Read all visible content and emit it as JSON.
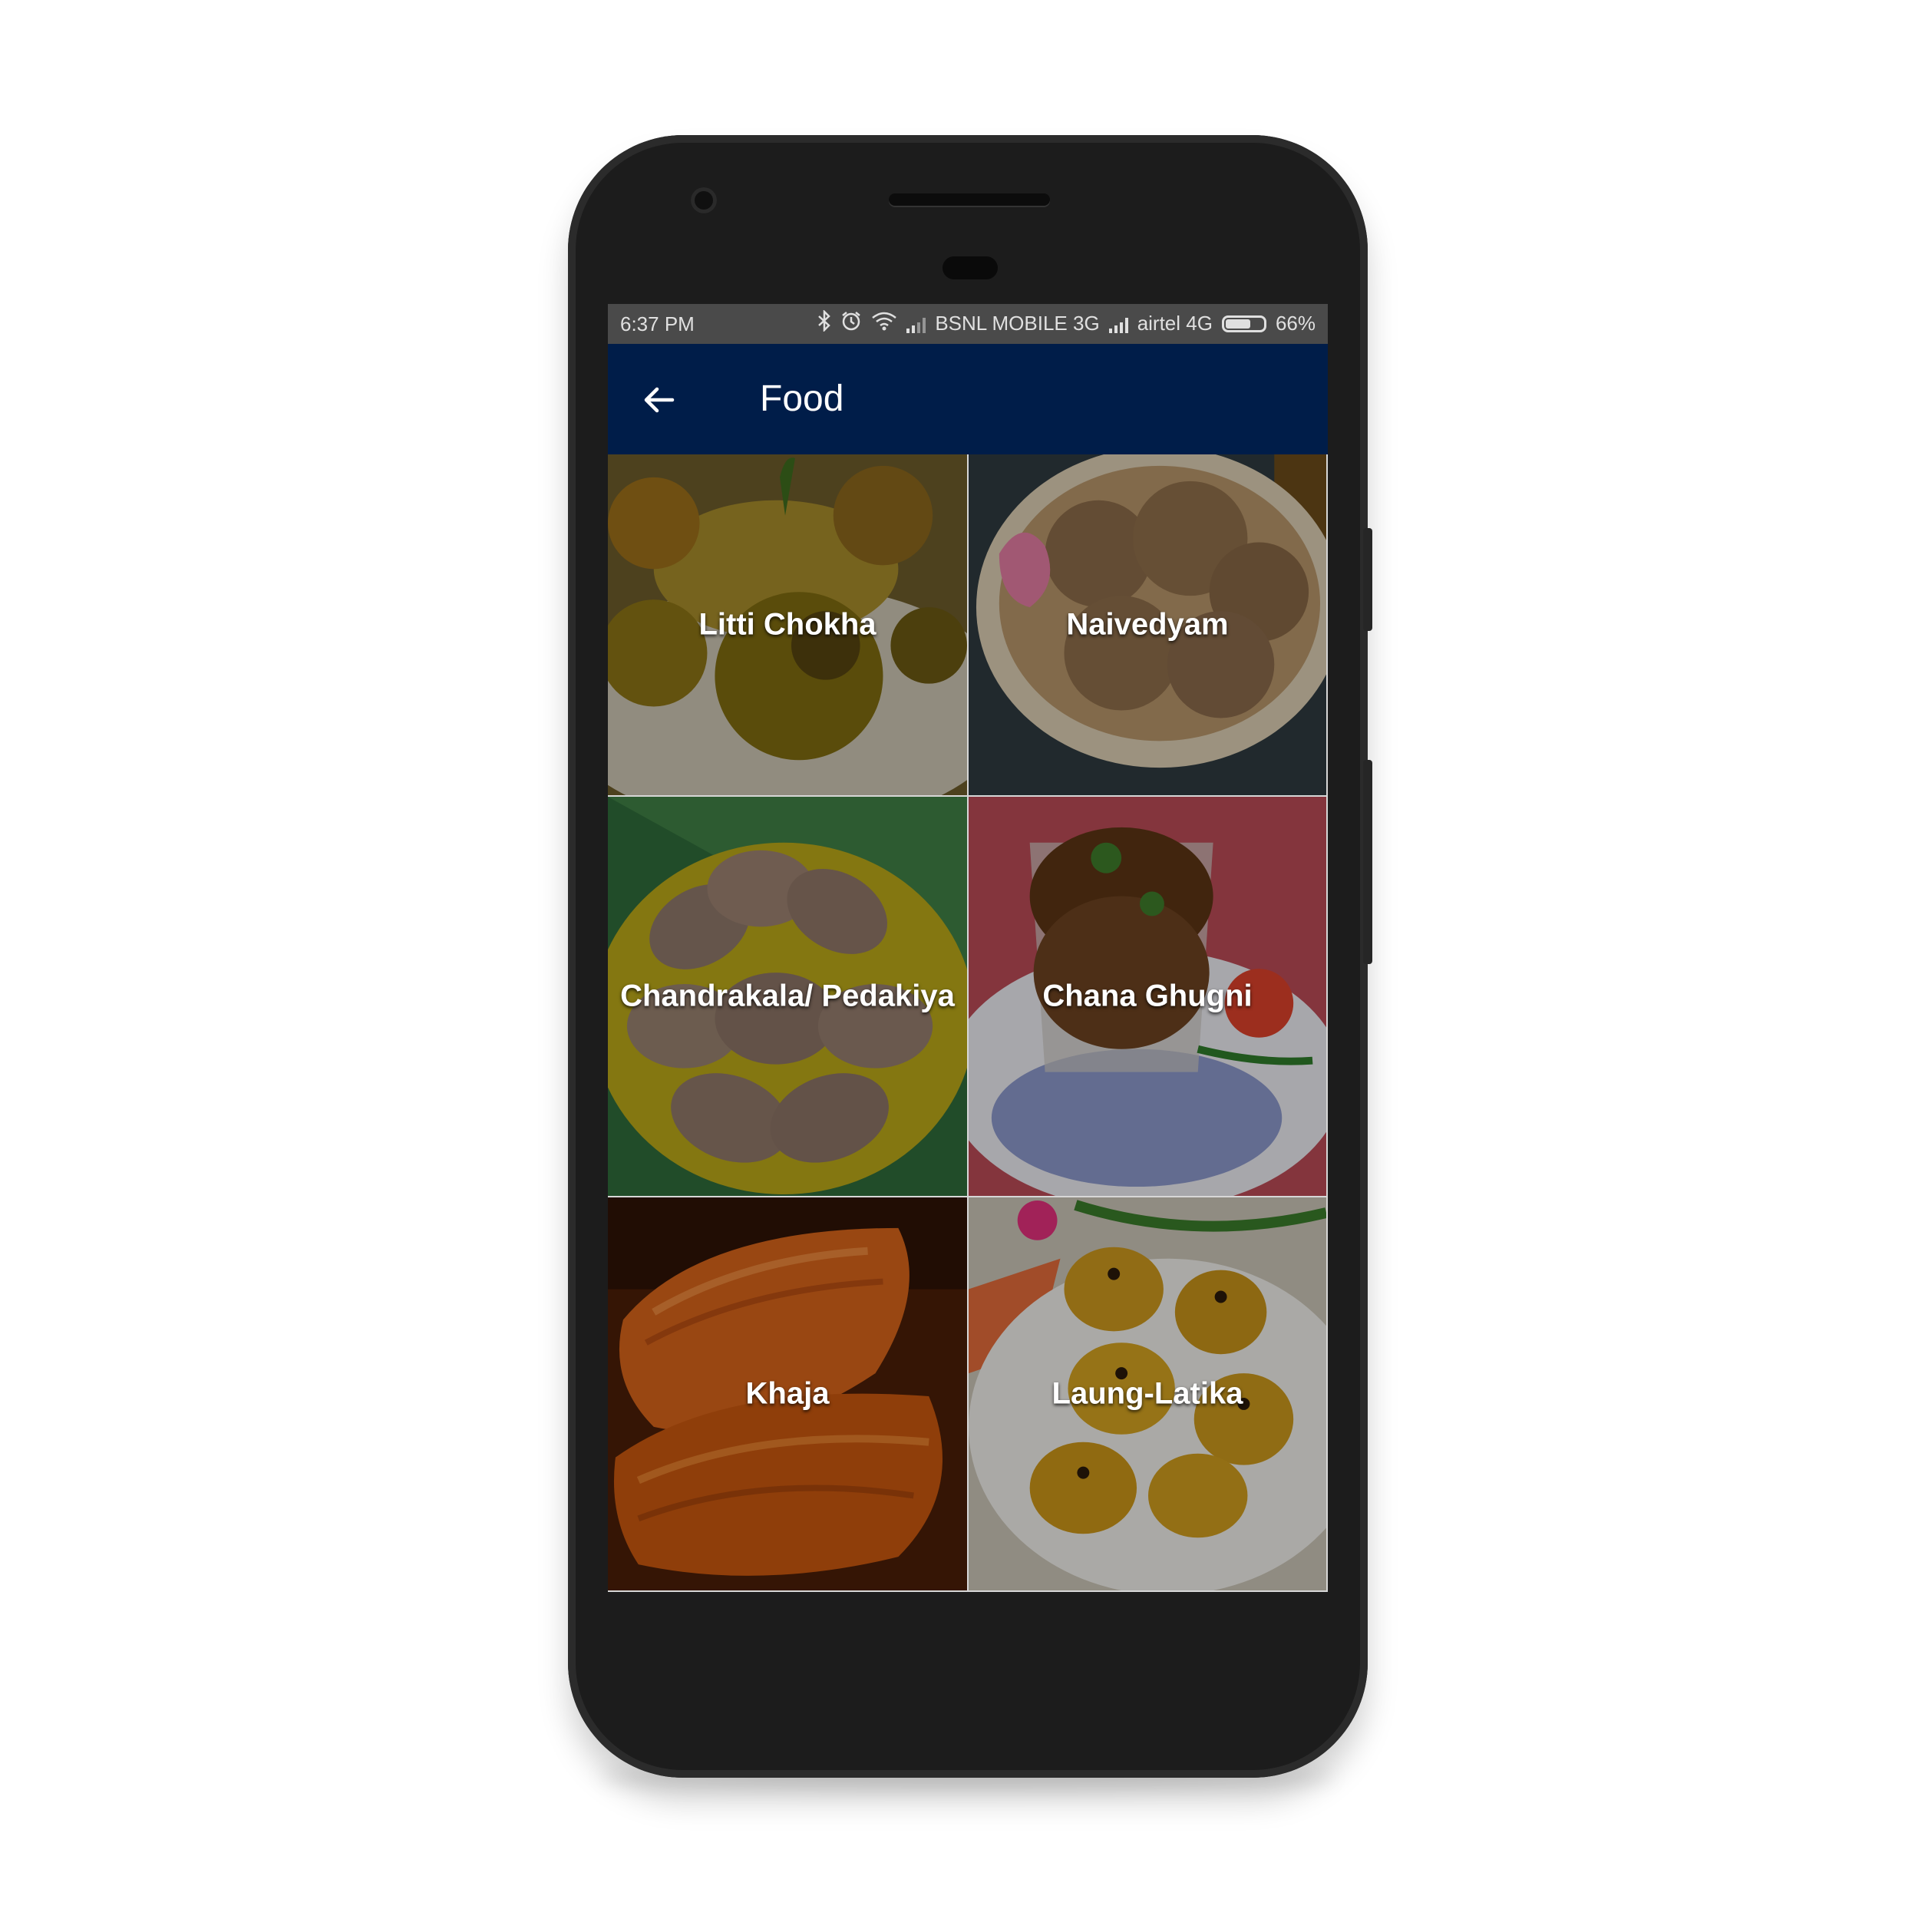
{
  "status_bar": {
    "time": "6:37 PM",
    "carrier1": "BSNL MOBILE 3G",
    "carrier2": "airtel 4G",
    "battery": "66%",
    "battery_level": 0.66,
    "icons": [
      "bluetooth-icon",
      "alarm-icon",
      "wifi-icon",
      "signal-icon",
      "signal-icon",
      "battery-icon"
    ]
  },
  "app_bar": {
    "title": "Food",
    "back_icon": "arrow-back-icon",
    "color": "#001d49"
  },
  "items": [
    {
      "label": "Litti Chokha"
    },
    {
      "label": "Naivedyam"
    },
    {
      "label": "Chandrakala/ Pedakiya"
    },
    {
      "label": "Chana Ghugni"
    },
    {
      "label": "Khaja"
    },
    {
      "label": "Laung-Latika"
    }
  ]
}
